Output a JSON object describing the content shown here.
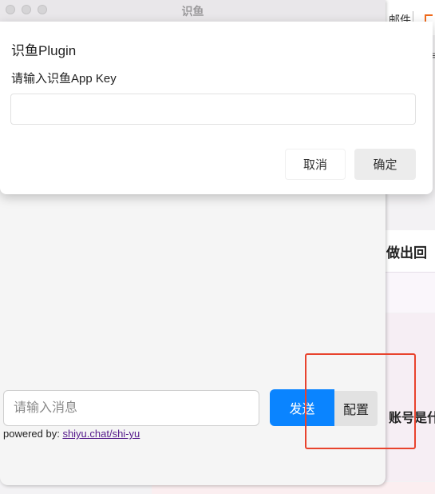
{
  "window": {
    "title": "识鱼",
    "traffic_lights": [
      "close-icon",
      "minimize-icon",
      "zoom-icon"
    ]
  },
  "dialog": {
    "title": "识鱼Plugin",
    "label": "请输入识鱼App Key",
    "input_value": "",
    "cancel_label": "取消",
    "confirm_label": "确定"
  },
  "composer": {
    "placeholder": "请输入消息",
    "value": "",
    "send_label": "发送",
    "config_label": "配置"
  },
  "footer": {
    "prefix": "powered by: ",
    "link_text": "shiyu.chat/shi-yu"
  },
  "background_app": {
    "header_text": "邮件",
    "snippet_1": "做出回",
    "snippet_2": "账号是什"
  },
  "colors": {
    "send_button": "#0a84ff",
    "config_button": "#e2e2e2",
    "highlight": "#e8432d",
    "link": "#551a8b"
  }
}
